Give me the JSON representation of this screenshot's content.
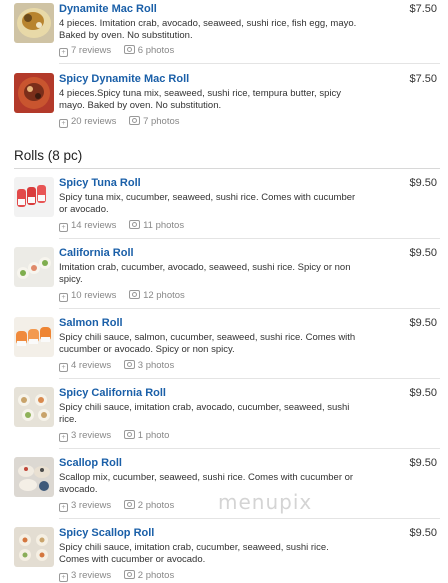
{
  "section": {
    "title": "Rolls (8 pc)"
  },
  "watermark": "menupix",
  "items": [
    {
      "name": "Dynamite Mac Roll",
      "price": "$7.50",
      "desc": "4 pieces. Imitation crab, avocado, seaweed, sushi rice, fish egg, mayo. Baked by oven. No substitution.",
      "reviews": "7 reviews",
      "photos": "6 photos",
      "thumb_icon": "baked-roll-photo"
    },
    {
      "name": "Spicy Dynamite Mac Roll",
      "price": "$7.50",
      "desc": "4 pieces.Spicy tuna mix, seaweed, sushi rice, tempura butter, spicy mayo. Baked by oven. No substitution.",
      "reviews": "20 reviews",
      "photos": "7 photos",
      "thumb_icon": "baked-roll-photo"
    },
    {
      "name": "Spicy Tuna Roll",
      "price": "$9.50",
      "desc": "Spicy tuna mix, cucumber, seaweed, sushi rice. Comes with cucumber or avocado.",
      "reviews": "14 reviews",
      "photos": "11 photos",
      "thumb_icon": "sushi-roll-photo"
    },
    {
      "name": "California Roll",
      "price": "$9.50",
      "desc": "Imitation crab, cucumber, avocado, seaweed, sushi rice. Spicy or non spicy.",
      "reviews": "10 reviews",
      "photos": "12 photos",
      "thumb_icon": "sushi-roll-photo"
    },
    {
      "name": "Salmon Roll",
      "price": "$9.50",
      "desc": "Spicy chili sauce, salmon, cucumber, seaweed, sushi rice. Comes with cucumber or avocado. Spicy or non spicy.",
      "reviews": "4 reviews",
      "photos": "3 photos",
      "thumb_icon": "sushi-roll-photo"
    },
    {
      "name": "Spicy California Roll",
      "price": "$9.50",
      "desc": "Spicy chili sauce, imitation crab, avocado, cucumber, seaweed, sushi rice.",
      "reviews": "3 reviews",
      "photos": "1 photo",
      "thumb_icon": "sushi-roll-photo"
    },
    {
      "name": "Scallop Roll",
      "price": "$9.50",
      "desc": "Scallop mix, cucumber, seaweed, sushi rice. Comes with cucumber or avocado.",
      "reviews": "3 reviews",
      "photos": "2 photos",
      "thumb_icon": "sushi-roll-photo"
    },
    {
      "name": "Spicy Scallop Roll",
      "price": "$9.50",
      "desc": "Spicy chili sauce, imitation crab, cucumber, seaweed, sushi rice. Comes with cucumber or avocado.",
      "reviews": "3 reviews",
      "photos": "2 photos",
      "thumb_icon": "sushi-roll-photo"
    }
  ]
}
